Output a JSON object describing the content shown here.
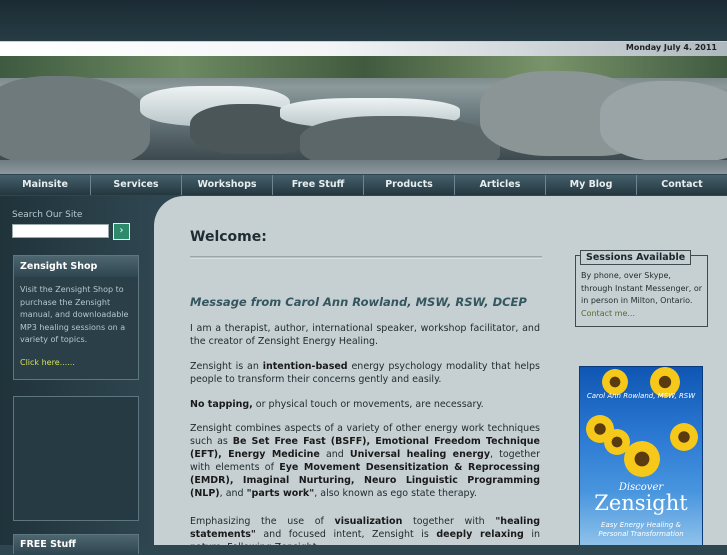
{
  "header": {
    "date": "Monday July 4. 2011"
  },
  "nav": {
    "items": [
      "Mainsite",
      "Services",
      "Workshops",
      "Free Stuff",
      "Products",
      "Articles",
      "My Blog",
      "Contact"
    ]
  },
  "sidebar": {
    "search_label": "Search Our Site",
    "search_placeholder": "",
    "search_button": "›",
    "shop": {
      "title": "Zensight Shop",
      "text": "Visit the Zensight Shop to purchase the Zensight manual, and downloadable MP3 healing sessions on a variety of topics.",
      "link": "Click here......"
    },
    "freestuff_title": "FREE Stuff"
  },
  "main": {
    "welcome": "Welcome:",
    "subtitle": "Message from Carol Ann Rowland, MSW, RSW, DCEP",
    "p1": "I am a therapist, author, international speaker, workshop facilitator, and the creator of Zensight Energy Healing.",
    "p2": {
      "a": "Zensight is an ",
      "b": "intention-based",
      "c": " energy psychology modality that helps people to transform their concerns gently and easily."
    },
    "p3": {
      "b": "No tapping,",
      "c": " or physical touch or movements, are necessary."
    },
    "p4": {
      "a": "Zensight combines aspects of a variety of other energy work techniques such as ",
      "b1": "Be Set Free Fast (BSFF), Emotional Freedom Technique (EFT), Energy Medicine",
      "c": " and ",
      "b2": "Universal healing energy",
      "d": ", together with elements of ",
      "b3": "Eye Movement Desensitization & Reprocessing (EMDR), Imaginal Nurturing, Neuro Linguistic Programming (NLP)",
      "e": ", and ",
      "b4": "\"parts work\"",
      "f": ", also known as ego state therapy."
    },
    "p5": {
      "a": "Emphasizing the use of ",
      "b1": "visualization",
      "c": " together with ",
      "b2": "\"healing statements\"",
      "d": " and focused intent, Zensight is ",
      "b3": "deeply relaxing",
      "e": " in nature. Following Zensight"
    }
  },
  "sessions": {
    "title": "Sessions Available",
    "text": "By phone, over Skype, through Instant Messenger, or in person in Milton, Ontario.",
    "link": "Contact me..."
  },
  "book": {
    "author": "Carol Ann Rowland, MSW, RSW",
    "discover": "Discover",
    "title": "Zensight",
    "tagline1": "Easy Energy Healing &",
    "tagline2": "Personal Transformation"
  }
}
